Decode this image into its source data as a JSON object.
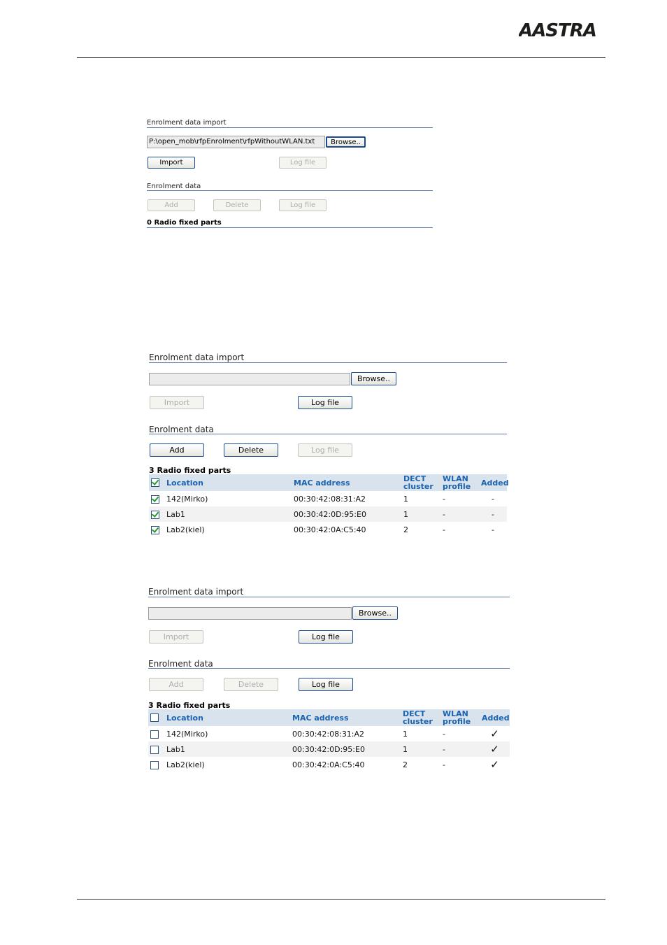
{
  "brand": {
    "logo_text": "AASTRA",
    "color": "#1d1d1b"
  },
  "panel1": {
    "import_title": "Enrolment data import",
    "file_value": "P:\\open_mob\\rfpEnrolment\\rfpWithoutWLAN.txt",
    "browse": "Browse..",
    "import": "Import",
    "logfile1": "Log file",
    "data_title": "Enrolment data",
    "add": "Add",
    "delete": "Delete",
    "logfile2": "Log file",
    "count": "0 Radio fixed parts"
  },
  "panel2": {
    "import_title": "Enrolment data import",
    "file_value": "",
    "browse": "Browse..",
    "import": "Import",
    "logfile1": "Log file",
    "data_title": "Enrolment data",
    "add": "Add",
    "delete": "Delete",
    "logfile2": "Log file",
    "count": "3 Radio fixed parts",
    "headers": {
      "location": "Location",
      "mac": "MAC address",
      "dect1": "DECT",
      "dect2": "cluster",
      "wlan1": "WLAN",
      "wlan2": "profile",
      "added": "Added"
    },
    "rows": [
      {
        "location": "142(Mirko)",
        "mac": "00:30:42:08:31:A2",
        "dect": "1",
        "wlan": "-",
        "added": "-"
      },
      {
        "location": "Lab1",
        "mac": "00:30:42:0D:95:E0",
        "dect": "1",
        "wlan": "-",
        "added": "-"
      },
      {
        "location": "Lab2(kiel)",
        "mac": "00:30:42:0A:C5:40",
        "dect": "2",
        "wlan": "-",
        "added": "-"
      }
    ]
  },
  "panel3": {
    "import_title": "Enrolment data import",
    "file_value": "",
    "browse": "Browse..",
    "import": "Import",
    "logfile1": "Log file",
    "data_title": "Enrolment data",
    "add": "Add",
    "delete": "Delete",
    "logfile2": "Log file",
    "count": "3 Radio fixed parts",
    "headers": {
      "location": "Location",
      "mac": "MAC address",
      "dect1": "DECT",
      "dect2": "cluster",
      "wlan1": "WLAN",
      "wlan2": "profile",
      "added": "Added"
    },
    "rows": [
      {
        "location": "142(Mirko)",
        "mac": "00:30:42:08:31:A2",
        "dect": "1",
        "wlan": "-",
        "added": "✓"
      },
      {
        "location": "Lab1",
        "mac": "00:30:42:0D:95:E0",
        "dect": "1",
        "wlan": "-",
        "added": "✓"
      },
      {
        "location": "Lab2(kiel)",
        "mac": "00:30:42:0A:C5:40",
        "dect": "2",
        "wlan": "-",
        "added": "✓"
      }
    ]
  }
}
